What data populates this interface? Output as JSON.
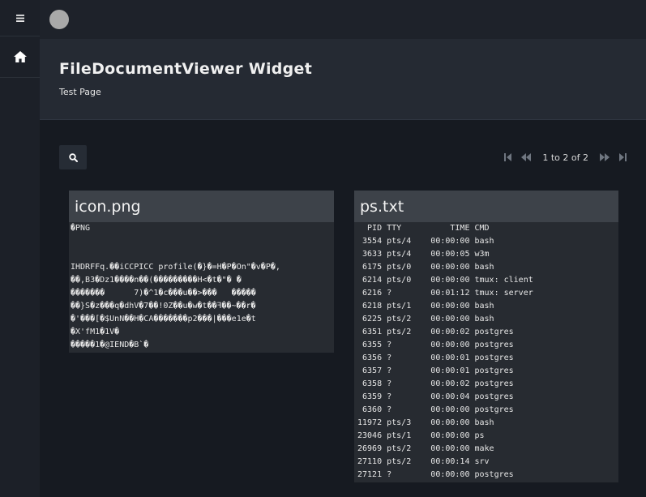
{
  "header": {
    "title": "FileDocumentViewer Widget",
    "subtitle": "Test Page"
  },
  "pager": {
    "text": "1 to 2 of 2"
  },
  "icons": {
    "menu": "hamburger-icon",
    "home": "home-icon",
    "avatar": "user-avatar",
    "search": "search-icon",
    "first": "first-page-icon",
    "prev": "previous-page-icon",
    "next": "next-page-icon",
    "last": "last-page-icon"
  },
  "colors": {
    "background": "#1e222a",
    "header": "#252a33",
    "main": "#161a21",
    "card_head": "#3d4249",
    "card_body": "#272b31"
  },
  "files": [
    {
      "name": "icon.png",
      "lines": [
        "�PNG",
        "",
        "",
        "IHDRFFq.��iCCPICC profile(�}�=H�P�On\"�v�P�,",
        "��,B3�Dz1����n��(���������H<�t�\"� �",
        "�������      7)�^1�c���u��>���   �����",
        "��}S�z���q�dhV�7��!0Z��u�w�t��ꟻ��~��r�",
        "�'���[�$UnN��H�CA�������p2���|���e1e�t",
        "�X'fM1�1V�",
        "�����1�@IEND�B`�"
      ]
    },
    {
      "name": "ps.txt",
      "lines": [
        "  PID TTY          TIME CMD",
        " 3554 pts/4    00:00:00 bash",
        " 3633 pts/4    00:00:05 w3m",
        " 6175 pts/0    00:00:00 bash",
        " 6214 pts/0    00:00:00 tmux: client",
        " 6216 ?        00:01:12 tmux: server",
        " 6218 pts/1    00:00:00 bash",
        " 6225 pts/2    00:00:00 bash",
        " 6351 pts/2    00:00:02 postgres",
        " 6355 ?        00:00:00 postgres",
        " 6356 ?        00:00:01 postgres",
        " 6357 ?        00:00:01 postgres",
        " 6358 ?        00:00:02 postgres",
        " 6359 ?        00:00:04 postgres",
        " 6360 ?        00:00:00 postgres",
        "11972 pts/3    00:00:00 bash",
        "23046 pts/1    00:00:00 ps",
        "26969 pts/2    00:00:00 make",
        "27110 pts/2    00:00:14 srv",
        "27121 ?        00:00:00 postgres"
      ]
    }
  ]
}
